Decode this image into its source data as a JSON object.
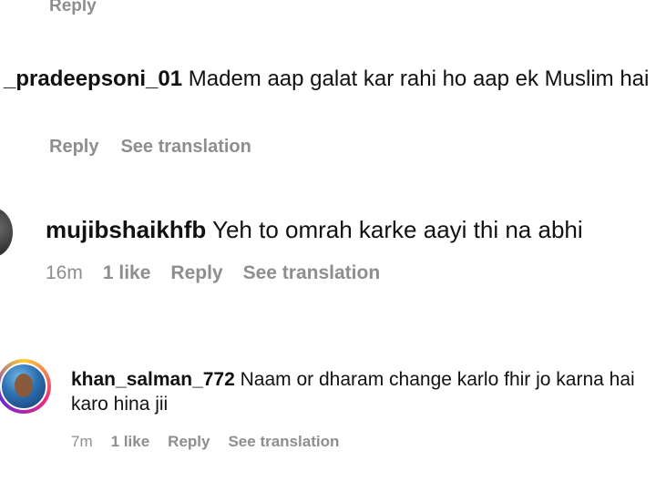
{
  "comments": [
    {
      "reply_label": "Reply"
    },
    {
      "username": "_pradeepsoni_01",
      "text": " Madem aap galat kar rahi ho aap ek Muslim hai",
      "reply_label": "Reply",
      "translate_label": "See translation"
    },
    {
      "username": "mujibshaikhfb",
      "text": " Yeh to omrah karke aayi thi na abhi",
      "time": "16m",
      "likes": "1 like",
      "reply_label": "Reply",
      "translate_label": "See translation"
    },
    {
      "username": "khan_salman_772",
      "text": " Naam or dharam change karlo fhir jo karna hai karo hina jii",
      "time": "7m",
      "likes": "1 like",
      "reply_label": "Reply",
      "translate_label": "See translation"
    }
  ]
}
